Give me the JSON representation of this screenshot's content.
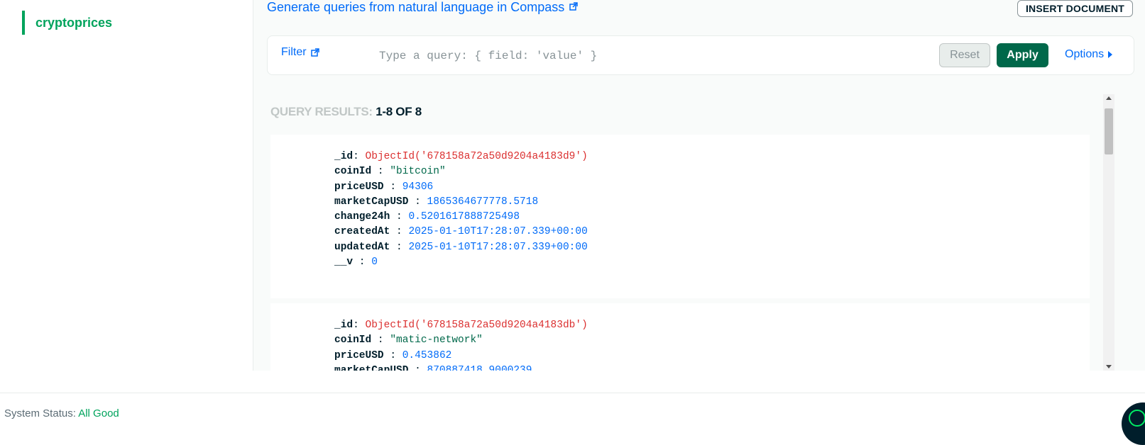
{
  "sidebar": {
    "items": [
      {
        "label": "cryptoprices",
        "active": true
      }
    ]
  },
  "toolbar": {
    "generate_link": "Generate queries from natural language in Compass",
    "insert_label": "INSERT DOCUMENT"
  },
  "filter": {
    "label": "Filter",
    "placeholder": "Type a query: { field: 'value' }",
    "reset_label": "Reset",
    "apply_label": "Apply",
    "options_label": "Options"
  },
  "results": {
    "label": "QUERY RESULTS:",
    "range": "1-8 OF 8"
  },
  "documents": [
    {
      "fields": [
        {
          "key": "_id",
          "sep": ": ",
          "value": "ObjectId('678158a72a50d9204a4183d9')",
          "type": "oid"
        },
        {
          "key": "coinId",
          "sep": " : ",
          "value": "\"bitcoin\"",
          "type": "str"
        },
        {
          "key": "priceUSD",
          "sep": " : ",
          "value": "94306",
          "type": "num"
        },
        {
          "key": "marketCapUSD",
          "sep": " : ",
          "value": "1865364677778.5718",
          "type": "num"
        },
        {
          "key": "change24h",
          "sep": " : ",
          "value": "0.5201617888725498",
          "type": "num"
        },
        {
          "key": "createdAt",
          "sep": " : ",
          "value": "2025-01-10T17:28:07.339+00:00",
          "type": "date"
        },
        {
          "key": "updatedAt",
          "sep": " : ",
          "value": "2025-01-10T17:28:07.339+00:00",
          "type": "date"
        },
        {
          "key": "__v",
          "sep": " : ",
          "value": "0",
          "type": "num"
        }
      ]
    },
    {
      "fields": [
        {
          "key": "_id",
          "sep": ": ",
          "value": "ObjectId('678158a72a50d9204a4183db')",
          "type": "oid"
        },
        {
          "key": "coinId",
          "sep": " : ",
          "value": "\"matic-network\"",
          "type": "str"
        },
        {
          "key": "priceUSD",
          "sep": " : ",
          "value": "0.453862",
          "type": "num"
        },
        {
          "key": "marketCapUSD",
          "sep": " : ",
          "value": "870887418.9000239",
          "type": "num"
        }
      ]
    }
  ],
  "footer": {
    "status_label": "System Status:",
    "status_value": "All Good"
  },
  "colors": {
    "accent_green": "#00a35c",
    "apply_green": "#00684a",
    "link_blue": "#016bf8",
    "oid_red": "#db3030"
  },
  "icons": {
    "external_link": "external-link-icon",
    "options_caret": "caret-right-icon",
    "chat": "chat-icon"
  }
}
